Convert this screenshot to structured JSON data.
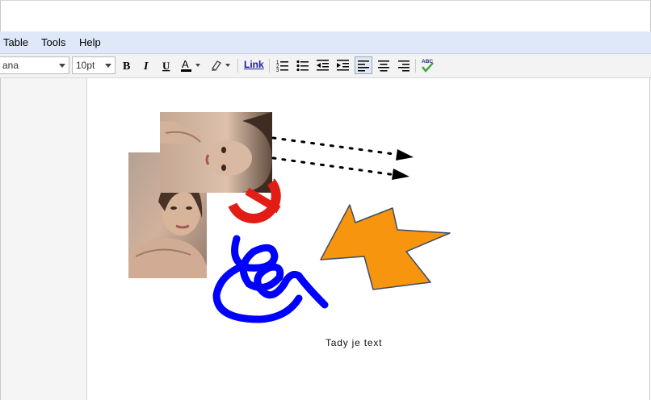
{
  "menu": {
    "items": [
      {
        "label": "Table"
      },
      {
        "label": "Tools"
      },
      {
        "label": "Help"
      }
    ]
  },
  "toolbar": {
    "font_family": "ana",
    "font_size": "10pt",
    "link_label": "Link",
    "buttons": [
      {
        "name": "bold",
        "glyph": "B"
      },
      {
        "name": "italic",
        "glyph": "I"
      },
      {
        "name": "underline",
        "glyph": "U"
      },
      {
        "name": "text-color",
        "glyph": "A"
      },
      {
        "name": "highlight-color",
        "glyph": "highlighter-icon"
      },
      {
        "name": "numbered-list",
        "glyph": "numbered-list-icon"
      },
      {
        "name": "bulleted-list",
        "glyph": "bulleted-list-icon"
      },
      {
        "name": "decrease-indent",
        "glyph": "outdent-icon"
      },
      {
        "name": "increase-indent",
        "glyph": "indent-icon"
      },
      {
        "name": "align-left",
        "glyph": "align-left-icon",
        "active": true
      },
      {
        "name": "align-center",
        "glyph": "align-center-icon"
      },
      {
        "name": "align-right",
        "glyph": "align-right-icon"
      },
      {
        "name": "spell-check",
        "glyph": "spellcheck-icon"
      }
    ],
    "spellcheck_label": "ABC"
  },
  "document": {
    "text": "Tady je text",
    "shapes": [
      {
        "type": "photo",
        "subject": "woman-portrait",
        "orientation": "upright"
      },
      {
        "type": "photo",
        "subject": "woman-portrait",
        "orientation": "rotated"
      },
      {
        "type": "no-entry-sign",
        "color": "#e41c16"
      },
      {
        "type": "dotted-arrow",
        "color": "#000000"
      },
      {
        "type": "dotted-arrow",
        "color": "#000000"
      },
      {
        "type": "star-burst",
        "fill": "#f7950f",
        "stroke": "#3f4b68"
      },
      {
        "type": "scribble",
        "color": "#0000ff"
      }
    ]
  }
}
